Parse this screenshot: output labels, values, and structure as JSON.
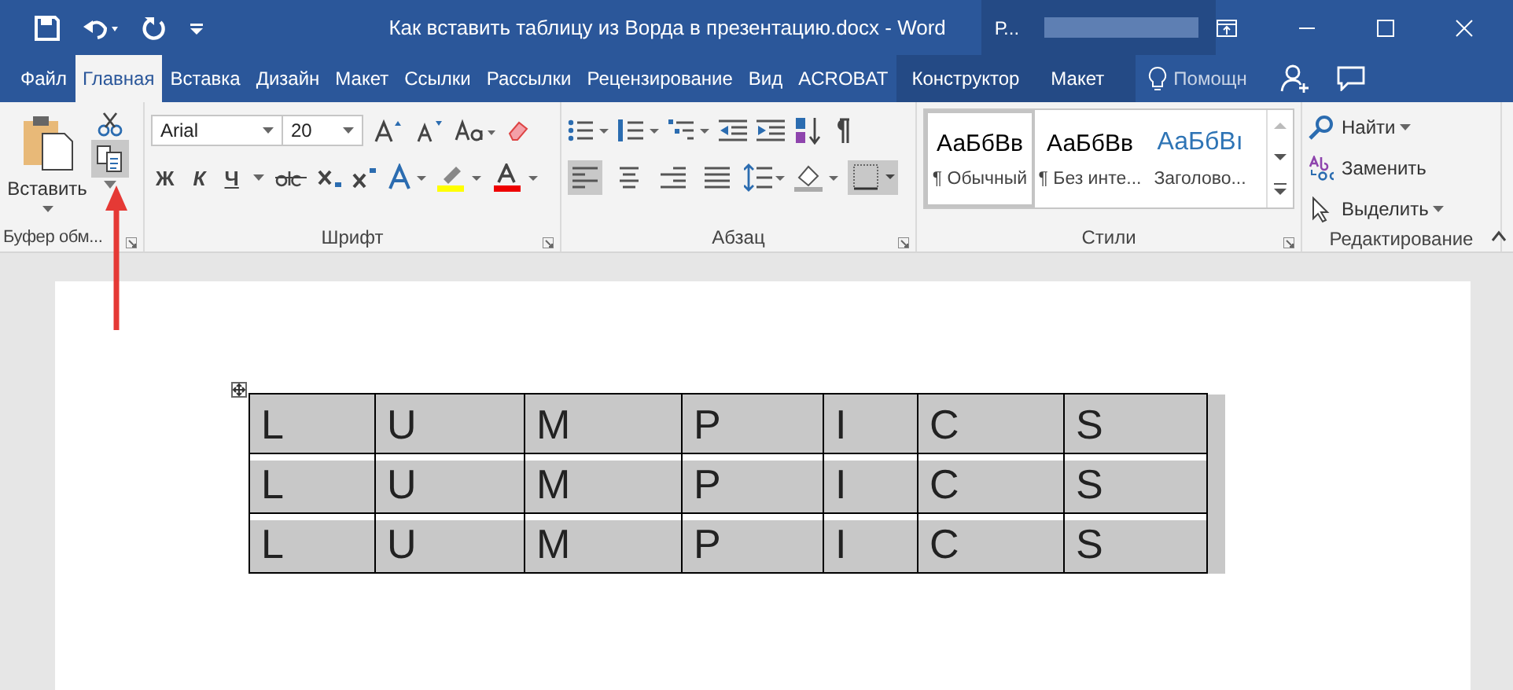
{
  "window": {
    "title": "Как вставить таблицу из Ворда в презентацию.docx - Word",
    "context_label": "Р..."
  },
  "tabs": [
    {
      "label": "Файл",
      "selected": false
    },
    {
      "label": "Главная",
      "selected": true
    },
    {
      "label": "Вставка",
      "selected": false
    },
    {
      "label": "Дизайн",
      "selected": false
    },
    {
      "label": "Макет",
      "selected": false
    },
    {
      "label": "Ссылки",
      "selected": false
    },
    {
      "label": "Рассылки",
      "selected": false
    },
    {
      "label": "Рецензирование",
      "selected": false
    },
    {
      "label": "Вид",
      "selected": false
    },
    {
      "label": "ACROBAT",
      "selected": false
    },
    {
      "label": "Конструктор",
      "selected": false,
      "kind": "context"
    },
    {
      "label": "Макет",
      "selected": false,
      "kind": "context"
    }
  ],
  "tell_me": {
    "placeholder": "Помощн"
  },
  "clipboard": {
    "paste": "Вставить",
    "label": "Буфер обм...",
    "copy_highlighted": true
  },
  "font": {
    "name": "Arial",
    "size": "20",
    "label": "Шрифт",
    "format_buttons": [
      "Ж",
      "К",
      "Ч"
    ]
  },
  "paragraph": {
    "label": "Абзац",
    "alignments": [
      {
        "selected": true
      },
      {
        "selected": false
      },
      {
        "selected": false
      },
      {
        "selected": false
      }
    ]
  },
  "styles": {
    "label": "Стили",
    "items": [
      {
        "sample": "АаБбВв",
        "name": "¶ Обычный",
        "selected": true,
        "kind": "normal"
      },
      {
        "sample": "АаБбВв",
        "name": "¶ Без инте...",
        "selected": false,
        "kind": "normal"
      },
      {
        "sample": "АаБбВı",
        "name": "Заголово...",
        "selected": false,
        "kind": "heading"
      }
    ]
  },
  "editing": {
    "label": "Редактирование",
    "items": [
      {
        "label": "Найти",
        "kind": "find"
      },
      {
        "label": "Заменить",
        "kind": "replace"
      },
      {
        "label": "Выделить",
        "kind": "select"
      }
    ]
  },
  "table": {
    "selected": true,
    "rows": [
      [
        "L",
        "U",
        "M",
        "P",
        "I",
        "C",
        "S"
      ],
      [
        "L",
        "U",
        "M",
        "P",
        "I",
        "C",
        "S"
      ],
      [
        "L",
        "U",
        "M",
        "P",
        "I",
        "C",
        "S"
      ]
    ]
  }
}
